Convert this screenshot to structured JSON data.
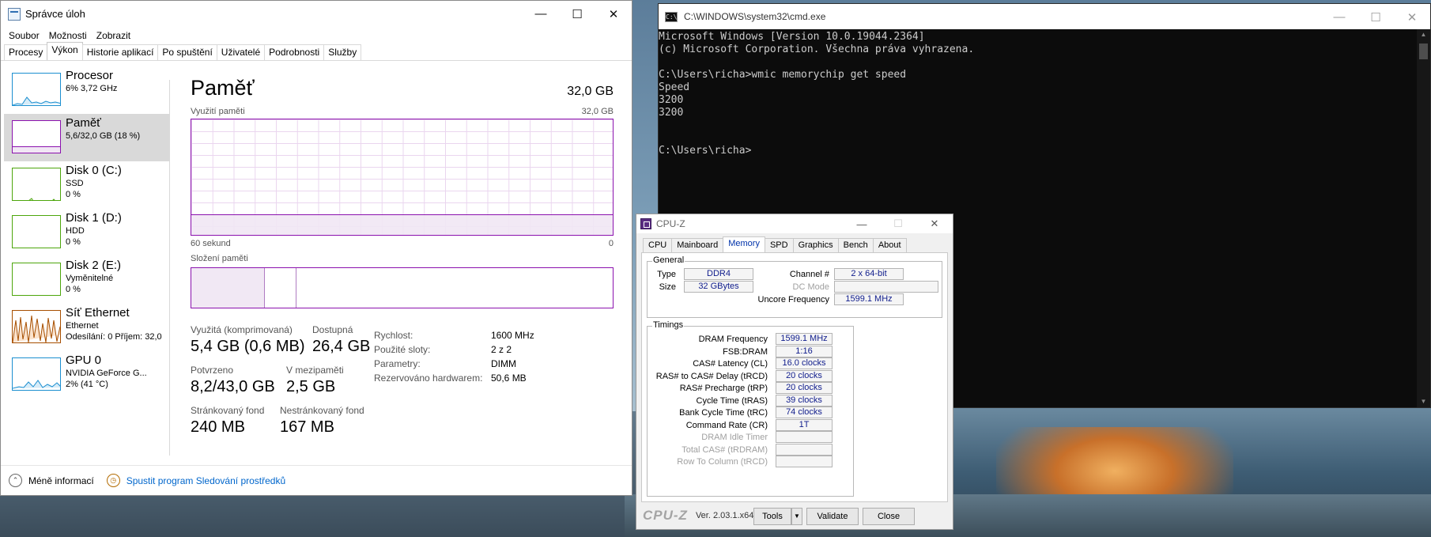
{
  "taskmgr": {
    "title": "Správce úloh",
    "menu": [
      "Soubor",
      "Možnosti",
      "Zobrazit"
    ],
    "tabs": [
      "Procesy",
      "Výkon",
      "Historie aplikací",
      "Po spuštění",
      "Uživatelé",
      "Podrobnosti",
      "Služby"
    ],
    "active_tab": "Výkon",
    "sidebar": [
      {
        "name": "Procesor",
        "sub1": "6% 3,72 GHz",
        "sub2": ""
      },
      {
        "name": "Paměť",
        "sub1": "5,6/32,0 GB (18 %)",
        "sub2": ""
      },
      {
        "name": "Disk 0 (C:)",
        "sub1": "SSD",
        "sub2": "0 %"
      },
      {
        "name": "Disk 1 (D:)",
        "sub1": "HDD",
        "sub2": "0 %"
      },
      {
        "name": "Disk 2 (E:)",
        "sub1": "Vyměnitelné",
        "sub2": "0 %"
      },
      {
        "name": "Síť Ethernet",
        "sub1": "Ethernet",
        "sub2": "Odesílání: 0 Příjem: 32,0"
      },
      {
        "name": "GPU 0",
        "sub1": "NVIDIA GeForce G...",
        "sub2": "2% (41 °C)"
      }
    ],
    "main": {
      "title": "Paměť",
      "total": "32,0 GB",
      "usage_label": "Využití paměti",
      "usage_max": "32,0 GB",
      "time_left": "60 sekund",
      "time_right": "0",
      "composition_label": "Složení paměti",
      "used_fraction": 0.18,
      "stats": {
        "used_label": "Využitá (komprimovaná)",
        "used_value": "5,4 GB (0,6 MB)",
        "avail_label": "Dostupná",
        "avail_value": "26,4 GB",
        "committed_label": "Potvrzeno",
        "committed_value": "8,2/43,0 GB",
        "cached_label": "V mezipaměti",
        "cached_value": "2,5 GB",
        "paged_label": "Stránkovaný fond",
        "paged_value": "240 MB",
        "nonpaged_label": "Nestránkovaný fond",
        "nonpaged_value": "167 MB"
      },
      "props": [
        {
          "k": "Rychlost:",
          "v": "1600 MHz"
        },
        {
          "k": "Použité sloty:",
          "v": "2 z 2"
        },
        {
          "k": "Parametry:",
          "v": "DIMM"
        },
        {
          "k": "Rezervováno hardwarem:",
          "v": "50,6 MB"
        }
      ]
    },
    "footer": {
      "less": "Méně informací",
      "monitor": "Spustit program Sledování prostředků"
    }
  },
  "cmd": {
    "title": "C:\\WINDOWS\\system32\\cmd.exe",
    "lines": [
      "Microsoft Windows [Version 10.0.19044.2364]",
      "(c) Microsoft Corporation. Všechna práva vyhrazena.",
      "",
      "C:\\Users\\richa>wmic memorychip get speed",
      "Speed",
      "3200",
      "3200",
      "",
      "",
      "C:\\Users\\richa>"
    ]
  },
  "cpuz": {
    "title": "CPU-Z",
    "tabs": [
      "CPU",
      "Mainboard",
      "Memory",
      "SPD",
      "Graphics",
      "Bench",
      "About"
    ],
    "active_tab": "Memory",
    "general": {
      "title": "General",
      "type_label": "Type",
      "type": "DDR4",
      "size_label": "Size",
      "size": "32 GBytes",
      "channel_label": "Channel #",
      "channel": "2 x 64-bit",
      "dcmode_label": "DC Mode",
      "dcmode": "",
      "uncore_label": "Uncore Frequency",
      "uncore": "1599.1 MHz"
    },
    "timings": {
      "title": "Timings",
      "rows": [
        {
          "label": "DRAM Frequency",
          "value": "1599.1 MHz",
          "disabled": false
        },
        {
          "label": "FSB:DRAM",
          "value": "1:16",
          "disabled": false
        },
        {
          "label": "CAS# Latency (CL)",
          "value": "16.0 clocks",
          "disabled": false
        },
        {
          "label": "RAS# to CAS# Delay (tRCD)",
          "value": "20 clocks",
          "disabled": false
        },
        {
          "label": "RAS# Precharge (tRP)",
          "value": "20 clocks",
          "disabled": false
        },
        {
          "label": "Cycle Time (tRAS)",
          "value": "39 clocks",
          "disabled": false
        },
        {
          "label": "Bank Cycle Time (tRC)",
          "value": "74 clocks",
          "disabled": false
        },
        {
          "label": "Command Rate (CR)",
          "value": "1T",
          "disabled": false
        },
        {
          "label": "DRAM Idle Timer",
          "value": "",
          "disabled": true
        },
        {
          "label": "Total CAS# (tRDRAM)",
          "value": "",
          "disabled": true
        },
        {
          "label": "Row To Column (tRCD)",
          "value": "",
          "disabled": true
        }
      ]
    },
    "bottom": {
      "logo": "CPU-Z",
      "version": "Ver. 2.03.1.x64",
      "tools": "Tools",
      "validate": "Validate",
      "close": "Close"
    }
  }
}
